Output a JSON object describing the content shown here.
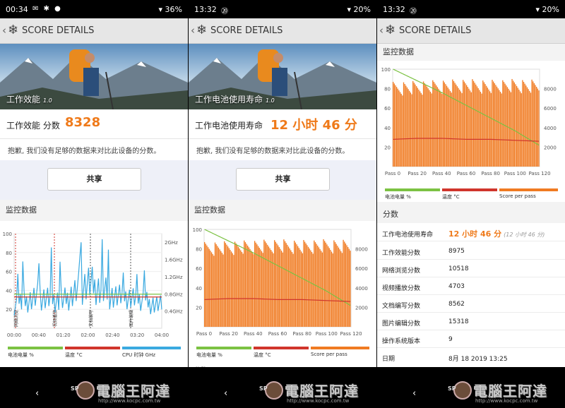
{
  "panels": [
    {
      "status": {
        "time": "00:34",
        "icons": "✉ ✱ ●",
        "battery": "36%"
      },
      "app_title": "SCORE DETAILS",
      "banner_title": "工作效能",
      "banner_version": "1.0",
      "score_label": "工作效能 分数",
      "score_value": "8328",
      "note": "抱歉, 我们没有足够的数据来对比此设备的分数。",
      "share_label": "共享",
      "monitor_title": "监控数据",
      "chart_left_ticks": [
        "100",
        "80",
        "60",
        "40",
        "20"
      ],
      "chart_right_ticks": [
        "2GHz",
        "1.6GHz",
        "1.2GHz",
        "0.8GHz",
        "0.4GHz"
      ],
      "chart_x_ticks": [
        "00:00",
        "00:40",
        "01:20",
        "02:00",
        "02:40",
        "03:20",
        "04:00"
      ],
      "chart_markers": [
        "网络浏览",
        "视频播放",
        "文档编写",
        "图片编辑"
      ],
      "legend": [
        {
          "label": "电池电量 %",
          "color": "#7cc243"
        },
        {
          "label": "温度 °C",
          "color": "#d0352c"
        },
        {
          "label": "CPU 时钟 GHz",
          "color": "#3aa9e0"
        }
      ]
    },
    {
      "status": {
        "time": "13:32",
        "icons": "⑳",
        "battery": "20%"
      },
      "app_title": "SCORE DETAILS",
      "banner_title": "工作电池使用寿命",
      "banner_version": "1.0",
      "score_label": "工作电池使用寿命",
      "score_value": "12 小时 46 分",
      "note": "抱歉, 我们没有足够的数据来对比此设备的分数。",
      "share_label": "共享",
      "monitor_title": "监控数据",
      "chart_left_ticks": [
        "100",
        "80",
        "60",
        "40",
        "20"
      ],
      "chart_right_ticks": [
        "8000",
        "6000",
        "4000",
        "2000"
      ],
      "chart_x_ticks": [
        "Pass 0",
        "Pass 20",
        "Pass 40",
        "Pass 60",
        "Pass 80",
        "Pass 100",
        "Pass 120"
      ],
      "legend": [
        {
          "label": "电池电量 %",
          "color": "#7cc243"
        },
        {
          "label": "温度 °C",
          "color": "#d0352c"
        },
        {
          "label": "Score per pass",
          "color": "#f07b22"
        }
      ],
      "next_section_cut": "分数"
    },
    {
      "status": {
        "time": "13:32",
        "icons": "⑳",
        "battery": "20%"
      },
      "app_title": "SCORE DETAILS",
      "monitor_title": "监控数据",
      "chart_left_ticks": [
        "100",
        "80",
        "60",
        "40",
        "20"
      ],
      "chart_right_ticks": [
        "8000",
        "6000",
        "4000",
        "2000"
      ],
      "chart_x_ticks": [
        "Pass 0",
        "Pass 20",
        "Pass 40",
        "Pass 60",
        "Pass 80",
        "Pass 100",
        "Pass 120"
      ],
      "legend": [
        {
          "label": "电池电量 %",
          "color": "#7cc243"
        },
        {
          "label": "温度 °C",
          "color": "#d0352c"
        },
        {
          "label": "Score per pass",
          "color": "#f07b22"
        }
      ],
      "scores_title": "分数",
      "scores": [
        {
          "label": "工作电池使用寿命",
          "value": "12 小时 46 分",
          "sub": "(12 小时 46 分)"
        },
        {
          "label": "工作效能分数",
          "value": "8975"
        },
        {
          "label": "网络浏览分数",
          "value": "10518"
        },
        {
          "label": "视频播放分数",
          "value": "4703"
        },
        {
          "label": "文档编写分数",
          "value": "8562"
        },
        {
          "label": "图片编辑分数",
          "value": "15318"
        },
        {
          "label": "操作系统版本",
          "value": "9"
        },
        {
          "label": "日期",
          "value": "8月 18 2019 13:25"
        }
      ]
    }
  ],
  "nav": {
    "back": "‹"
  },
  "watermark": {
    "badge": "SP",
    "text": "電腦王阿達",
    "url": "http://www.kocpc.com.tw"
  },
  "chart_data": [
    {
      "type": "line",
      "x": [
        "00:00",
        "00:40",
        "01:20",
        "02:00",
        "02:40",
        "03:20",
        "04:00"
      ],
      "series": [
        {
          "name": "电池电量 %",
          "values": [
            36,
            36,
            36,
            36,
            36,
            36,
            36
          ]
        },
        {
          "name": "温度 °C",
          "values": [
            33,
            33,
            33,
            33,
            33,
            33,
            33
          ]
        },
        {
          "name": "CPU 时钟 GHz",
          "values": [
            0.5,
            0.7,
            0.6,
            1.0,
            0.7,
            0.6,
            0.5
          ]
        }
      ],
      "ylim": [
        0,
        100
      ],
      "y2lim": [
        0,
        2.2
      ]
    },
    {
      "type": "bar",
      "x": [
        "Pass 0",
        "Pass 20",
        "Pass 40",
        "Pass 60",
        "Pass 80",
        "Pass 100",
        "Pass 120"
      ],
      "series": [
        {
          "name": "Score per pass",
          "values": [
            8700,
            8800,
            8900,
            9000,
            8900,
            9000,
            8900
          ]
        },
        {
          "name": "电池电量 %",
          "values": [
            100,
            88,
            76,
            63,
            50,
            37,
            22
          ]
        },
        {
          "name": "温度 °C",
          "values": [
            28,
            29,
            29,
            28,
            28,
            27,
            26
          ]
        }
      ],
      "ylim": [
        0,
        100
      ],
      "y2lim": [
        0,
        10000
      ]
    }
  ]
}
